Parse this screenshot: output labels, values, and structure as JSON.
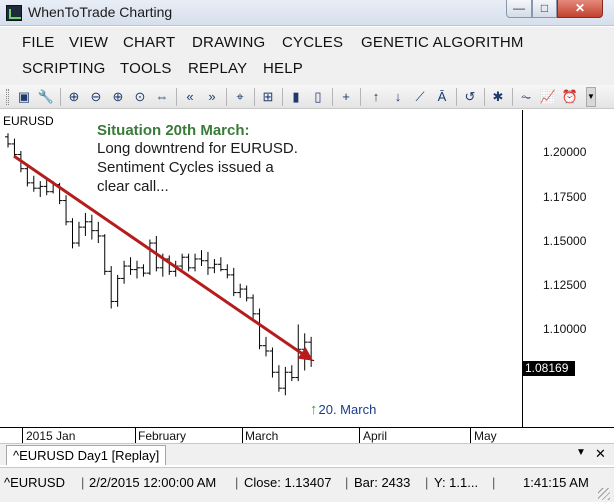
{
  "window": {
    "title": "WhenToTrade Charting",
    "buttons": {
      "minimize": "—",
      "maximize": "□",
      "close": "✕"
    }
  },
  "menu": {
    "items": [
      "FILE",
      "VIEW",
      "CHART",
      "DRAWING",
      "CYCLES",
      "GENETIC ALGORITHM",
      "SCRIPTING",
      "TOOLS",
      "REPLAY",
      "HELP"
    ]
  },
  "toolbar": {
    "icons": [
      {
        "name": "chart-settings-icon",
        "glyph": "▣"
      },
      {
        "name": "wrench-icon",
        "glyph": "🔧"
      },
      {
        "name": "zoom-in-icon",
        "glyph": "⊕"
      },
      {
        "name": "zoom-out-icon",
        "glyph": "⊖"
      },
      {
        "name": "zoom-area-icon",
        "glyph": "⊕"
      },
      {
        "name": "zoom-reset-icon",
        "glyph": "⊙"
      },
      {
        "name": "fit-icon",
        "glyph": "⇔"
      },
      {
        "name": "scroll-left-icon",
        "glyph": "«"
      },
      {
        "name": "scroll-right-icon",
        "glyph": "»"
      },
      {
        "name": "crosshair-icon",
        "glyph": "⌖"
      },
      {
        "name": "grid-icon",
        "glyph": "⊞"
      },
      {
        "name": "battery-full-icon",
        "glyph": "▮"
      },
      {
        "name": "battery-empty-icon",
        "glyph": "▯"
      },
      {
        "name": "plus-icon",
        "glyph": "+"
      },
      {
        "name": "arrow-up-icon",
        "glyph": "↑"
      },
      {
        "name": "arrow-down-icon",
        "glyph": "↓"
      },
      {
        "name": "trendline-icon",
        "glyph": "⟋"
      },
      {
        "name": "fibonacci-icon",
        "glyph": "Ā"
      },
      {
        "name": "history-icon",
        "glyph": "↺"
      },
      {
        "name": "bug-icon",
        "glyph": "✱"
      },
      {
        "name": "oscillator-icon",
        "glyph": "⏦"
      },
      {
        "name": "indicator-chart-icon",
        "glyph": "📈"
      },
      {
        "name": "alarm-clock-icon",
        "glyph": "⏰"
      }
    ]
  },
  "chart": {
    "symbol": "EURUSD",
    "annotation": {
      "title": "Situation 20th March:",
      "lines": [
        "Long downtrend for EURUSD.",
        "Sentiment Cycles issued a",
        "clear call..."
      ]
    },
    "marker_label": "20. March",
    "last_price": "1.08169",
    "colors": {
      "trend_arrow": "#b71c1c",
      "annotation_title": "#3b7a3b",
      "marker_arrow": "#24b024",
      "bars": "#000000"
    }
  },
  "chart_data": {
    "type": "ohlc",
    "symbol": "EURUSD",
    "timeframe": "Day1",
    "ylim": [
      1.065,
      1.21
    ],
    "y_ticks": [
      "1.20000",
      "1.17500",
      "1.15000",
      "1.12500",
      "1.10000"
    ],
    "x_ticks": [
      "2015 Jan",
      "February",
      "March",
      "April",
      "May"
    ],
    "bars": [
      {
        "x": 0,
        "o": 1.208,
        "h": 1.21,
        "l": 1.202,
        "c": 1.204
      },
      {
        "x": 1,
        "o": 1.204,
        "h": 1.207,
        "l": 1.196,
        "c": 1.198
      },
      {
        "x": 2,
        "o": 1.198,
        "h": 1.2,
        "l": 1.188,
        "c": 1.19
      },
      {
        "x": 3,
        "o": 1.19,
        "h": 1.192,
        "l": 1.18,
        "c": 1.182
      },
      {
        "x": 4,
        "o": 1.182,
        "h": 1.186,
        "l": 1.177,
        "c": 1.179
      },
      {
        "x": 5,
        "o": 1.179,
        "h": 1.183,
        "l": 1.174,
        "c": 1.18
      },
      {
        "x": 6,
        "o": 1.18,
        "h": 1.184,
        "l": 1.175,
        "c": 1.177
      },
      {
        "x": 7,
        "o": 1.177,
        "h": 1.183,
        "l": 1.176,
        "c": 1.181
      },
      {
        "x": 8,
        "o": 1.181,
        "h": 1.182,
        "l": 1.17,
        "c": 1.172
      },
      {
        "x": 9,
        "o": 1.172,
        "h": 1.175,
        "l": 1.158,
        "c": 1.16
      },
      {
        "x": 10,
        "o": 1.16,
        "h": 1.162,
        "l": 1.145,
        "c": 1.148
      },
      {
        "x": 11,
        "o": 1.148,
        "h": 1.16,
        "l": 1.146,
        "c": 1.157
      },
      {
        "x": 12,
        "o": 1.157,
        "h": 1.165,
        "l": 1.152,
        "c": 1.16
      },
      {
        "x": 13,
        "o": 1.16,
        "h": 1.164,
        "l": 1.15,
        "c": 1.155
      },
      {
        "x": 14,
        "o": 1.155,
        "h": 1.16,
        "l": 1.148,
        "c": 1.152
      },
      {
        "x": 15,
        "o": 1.152,
        "h": 1.153,
        "l": 1.13,
        "c": 1.132
      },
      {
        "x": 16,
        "o": 1.132,
        "h": 1.135,
        "l": 1.111,
        "c": 1.115
      },
      {
        "x": 17,
        "o": 1.115,
        "h": 1.13,
        "l": 1.112,
        "c": 1.128
      },
      {
        "x": 18,
        "o": 1.128,
        "h": 1.138,
        "l": 1.125,
        "c": 1.135
      },
      {
        "x": 19,
        "o": 1.135,
        "h": 1.14,
        "l": 1.13,
        "c": 1.133
      },
      {
        "x": 20,
        "o": 1.133,
        "h": 1.138,
        "l": 1.128,
        "c": 1.134
      },
      {
        "x": 21,
        "o": 1.134,
        "h": 1.136,
        "l": 1.129,
        "c": 1.131
      },
      {
        "x": 22,
        "o": 1.131,
        "h": 1.15,
        "l": 1.13,
        "c": 1.148
      },
      {
        "x": 23,
        "o": 1.148,
        "h": 1.152,
        "l": 1.132,
        "c": 1.134
      },
      {
        "x": 24,
        "o": 1.134,
        "h": 1.142,
        "l": 1.129,
        "c": 1.139
      },
      {
        "x": 25,
        "o": 1.139,
        "h": 1.141,
        "l": 1.13,
        "c": 1.132
      },
      {
        "x": 26,
        "o": 1.132,
        "h": 1.138,
        "l": 1.129,
        "c": 1.135
      },
      {
        "x": 27,
        "o": 1.135,
        "h": 1.142,
        "l": 1.133,
        "c": 1.14
      },
      {
        "x": 28,
        "o": 1.14,
        "h": 1.142,
        "l": 1.132,
        "c": 1.134
      },
      {
        "x": 29,
        "o": 1.134,
        "h": 1.142,
        "l": 1.132,
        "c": 1.139
      },
      {
        "x": 30,
        "o": 1.139,
        "h": 1.144,
        "l": 1.135,
        "c": 1.138
      },
      {
        "x": 31,
        "o": 1.138,
        "h": 1.143,
        "l": 1.13,
        "c": 1.134
      },
      {
        "x": 32,
        "o": 1.134,
        "h": 1.139,
        "l": 1.131,
        "c": 1.136
      },
      {
        "x": 33,
        "o": 1.136,
        "h": 1.14,
        "l": 1.132,
        "c": 1.133
      },
      {
        "x": 34,
        "o": 1.133,
        "h": 1.136,
        "l": 1.128,
        "c": 1.13
      },
      {
        "x": 35,
        "o": 1.13,
        "h": 1.134,
        "l": 1.118,
        "c": 1.12
      },
      {
        "x": 36,
        "o": 1.12,
        "h": 1.125,
        "l": 1.117,
        "c": 1.122
      },
      {
        "x": 37,
        "o": 1.122,
        "h": 1.124,
        "l": 1.115,
        "c": 1.117
      },
      {
        "x": 38,
        "o": 1.117,
        "h": 1.119,
        "l": 1.105,
        "c": 1.108
      },
      {
        "x": 39,
        "o": 1.108,
        "h": 1.111,
        "l": 1.088,
        "c": 1.09
      },
      {
        "x": 40,
        "o": 1.09,
        "h": 1.095,
        "l": 1.084,
        "c": 1.087
      },
      {
        "x": 41,
        "o": 1.087,
        "h": 1.089,
        "l": 1.072,
        "c": 1.075
      },
      {
        "x": 42,
        "o": 1.075,
        "h": 1.079,
        "l": 1.064,
        "c": 1.066
      },
      {
        "x": 43,
        "o": 1.066,
        "h": 1.078,
        "l": 1.062,
        "c": 1.075
      },
      {
        "x": 44,
        "o": 1.075,
        "h": 1.079,
        "l": 1.07,
        "c": 1.072
      },
      {
        "x": 45,
        "o": 1.072,
        "h": 1.102,
        "l": 1.07,
        "c": 1.088
      },
      {
        "x": 46,
        "o": 1.088,
        "h": 1.097,
        "l": 1.076,
        "c": 1.092
      },
      {
        "x": 47,
        "o": 1.092,
        "h": 1.095,
        "l": 1.078,
        "c": 1.0817
      }
    ],
    "trend_arrow": {
      "from": {
        "x": 0,
        "y": 1.205
      },
      "to": {
        "x": 47,
        "y": 1.086
      }
    },
    "marker": {
      "x": 45,
      "label": "20. March"
    }
  },
  "tab": {
    "label": "^EURUSD Day1 [Replay]",
    "dropdown": "▼",
    "close": "✕"
  },
  "status": {
    "symbol": "^EURUSD",
    "datetime": "2/2/2015 12:00:00 AM",
    "close": "Close: 1.13407",
    "bar": "Bar: 2433",
    "y": "Y: 1.1...",
    "time": "1:41:15 AM"
  }
}
